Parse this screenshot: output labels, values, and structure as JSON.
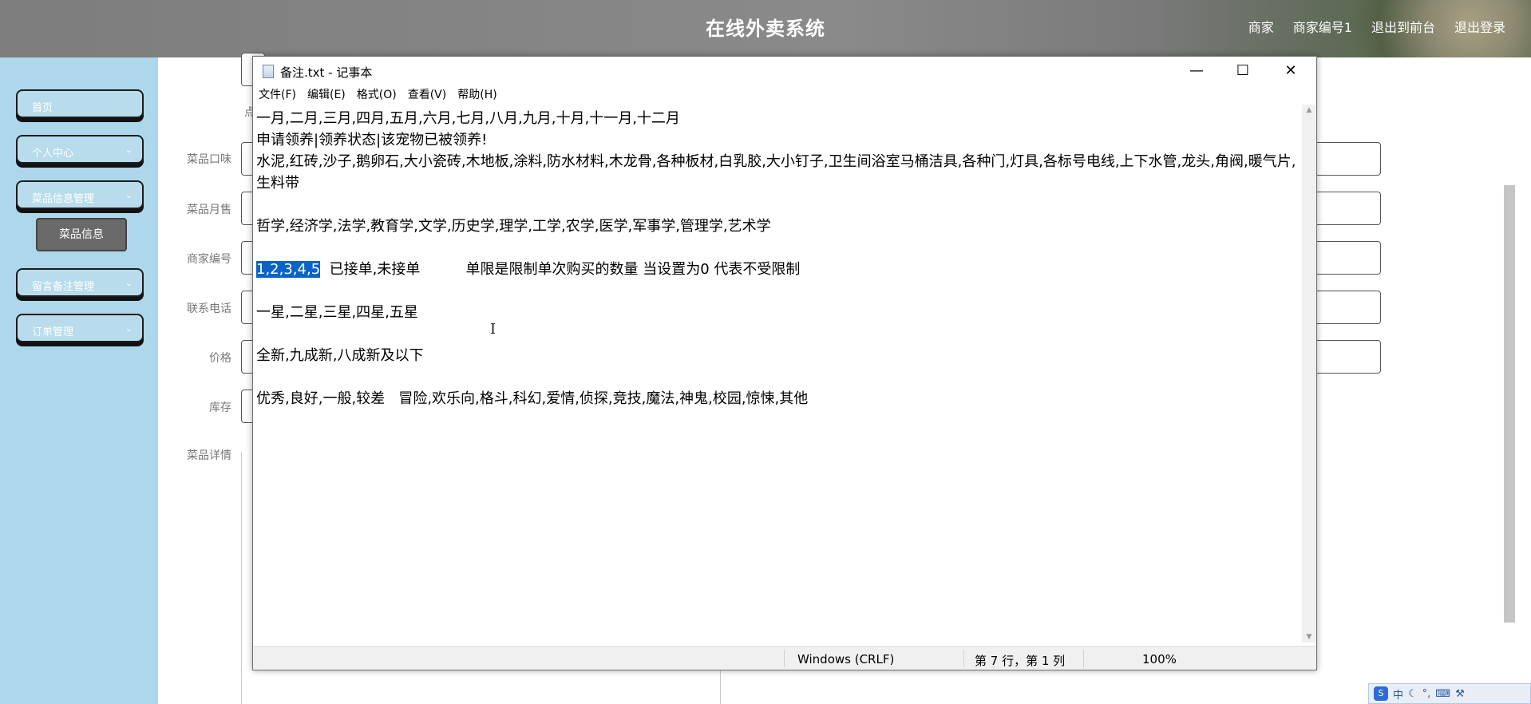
{
  "app": {
    "title": "在线外卖系统",
    "header_links": [
      "商家",
      "商家编号1",
      "退出到前台",
      "退出登录"
    ]
  },
  "sidebar": {
    "items": [
      {
        "label": "首页",
        "has_chevron": false
      },
      {
        "label": "个人中心",
        "has_chevron": true
      },
      {
        "label": "菜品信息管理",
        "has_chevron": true
      },
      {
        "label": "留言备注管理",
        "has_chevron": true
      },
      {
        "label": "订单管理",
        "has_chevron": true
      }
    ],
    "active_sub_item": "菜品信息"
  },
  "form": {
    "labels": [
      "菜品口味",
      "菜品月售",
      "商家编号",
      "联系电话",
      "价格",
      "库存",
      "菜品详情"
    ],
    "partial_label": "点"
  },
  "notepad": {
    "title": "备注.txt - 记事本",
    "menu": [
      "文件(F)",
      "编辑(E)",
      "格式(O)",
      "查看(V)",
      "帮助(H)"
    ],
    "lines": [
      "一月,二月,三月,四月,五月,六月,七月,八月,九月,十月,十一月,十二月",
      "申请领养|领养状态|该宠物已被领养!",
      "水泥,红砖,沙子,鹅卵石,大小瓷砖,木地板,涂料,防水材料,木龙骨,各种板材,白乳胶,大小钉子,卫生间浴室马桶洁具,各种门,灯具,各标号电线,上下水管,龙头,角阀,暖气片,生料带",
      "",
      "哲学,经济学,法学,教育学,文学,历史学,理学,工学,农学,医学,军事学,管理学,艺术学",
      ""
    ],
    "selected_text": "1,2,3,4,5",
    "line7_rest": "  已接单,未接单          单限是限制单次购买的数量 当设置为0 代表不受限制",
    "lines_after": [
      "",
      "一星,二星,三星,四星,五星",
      "",
      "全新,九成新,八成新及以下",
      "",
      "优秀,良好,一般,较差   冒险,欢乐向,格斗,科幻,爱情,侦探,竞技,魔法,神鬼,校园,惊悚,其他"
    ],
    "status": {
      "encoding": "Windows (CRLF)",
      "position": "第 7 行，第 1 列",
      "zoom": "100%"
    }
  },
  "ime": {
    "lang": "中"
  }
}
